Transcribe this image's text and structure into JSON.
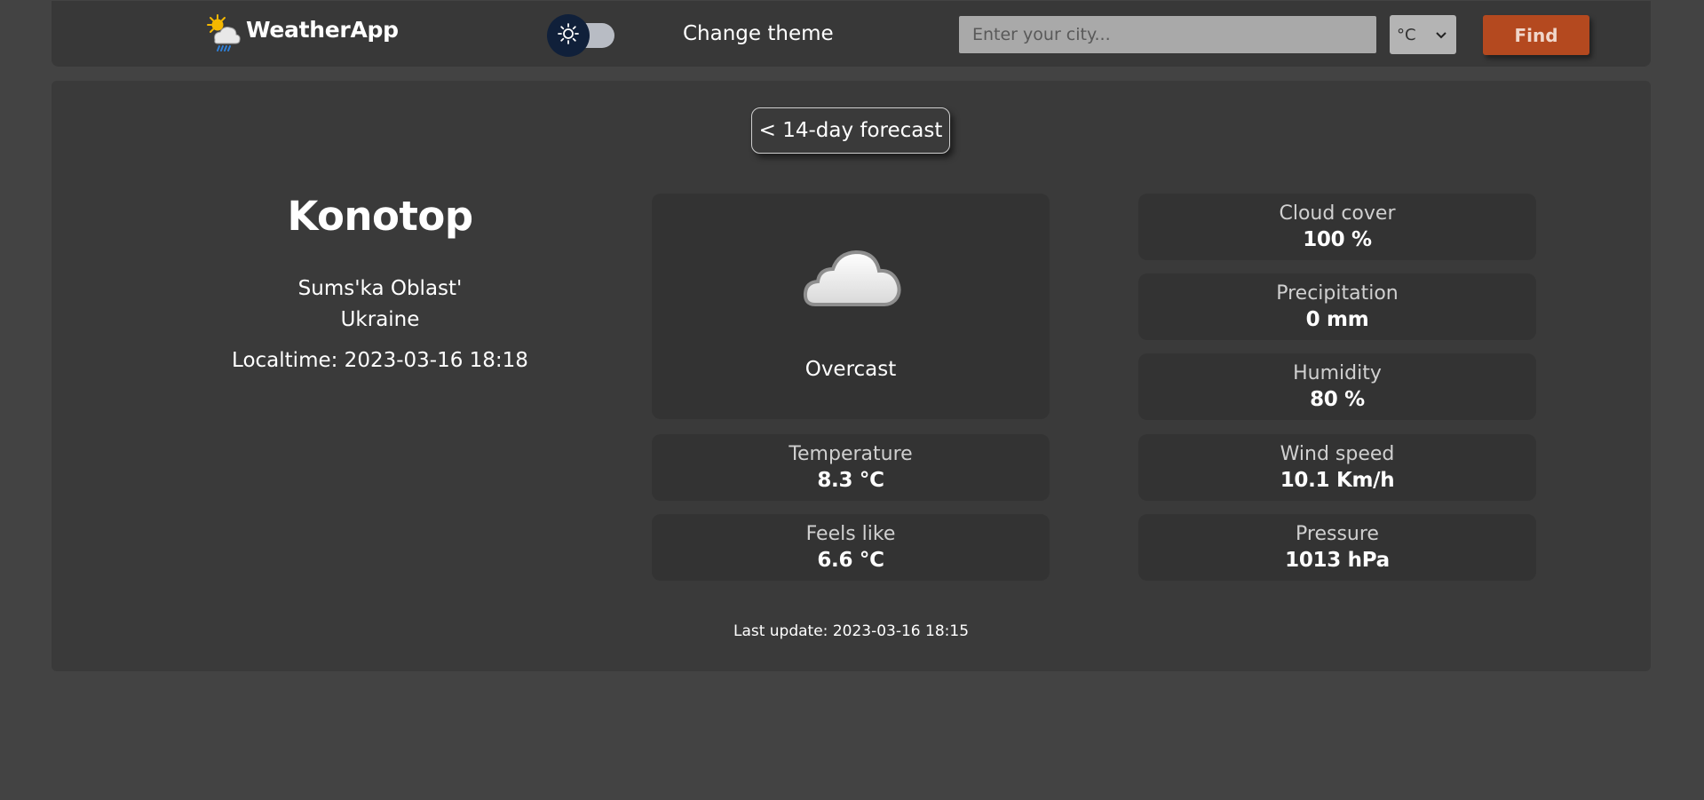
{
  "app": {
    "name": "WeatherApp",
    "logo_icon": "sun-cloud-rain-icon"
  },
  "header": {
    "theme_toggle_label": "Change theme",
    "theme_icon": "sun-icon",
    "search_placeholder": "Enter your city...",
    "search_value": "",
    "unit_selected": "°C",
    "find_label": "Find"
  },
  "main": {
    "forecast_button": "< 14-day forecast",
    "city": "Konotop",
    "region": "Sums'ka Oblast'",
    "country": "Ukraine",
    "localtime": "Localtime: 2023-03-16 18:18",
    "condition": {
      "icon": "cloud-icon",
      "text": "Overcast"
    },
    "stats": {
      "temperature": {
        "label": "Temperature",
        "value": "8.3 °C"
      },
      "feels_like": {
        "label": "Feels like",
        "value": "6.6 °C"
      },
      "cloud_cover": {
        "label": "Cloud cover",
        "value": "100 %"
      },
      "precipitation": {
        "label": "Precipitation",
        "value": "0 mm"
      },
      "humidity": {
        "label": "Humidity",
        "value": "80 %"
      },
      "wind_speed": {
        "label": "Wind speed",
        "value": "10.1 Km/h"
      },
      "pressure": {
        "label": "Pressure",
        "value": "1013 hPa"
      }
    },
    "last_update": "Last update: 2023-03-16 18:15"
  },
  "colors": {
    "page_bg": "#434343",
    "panel_bg": "#3a3a3a",
    "tile_bg": "#333333",
    "accent": "#b4491f"
  }
}
